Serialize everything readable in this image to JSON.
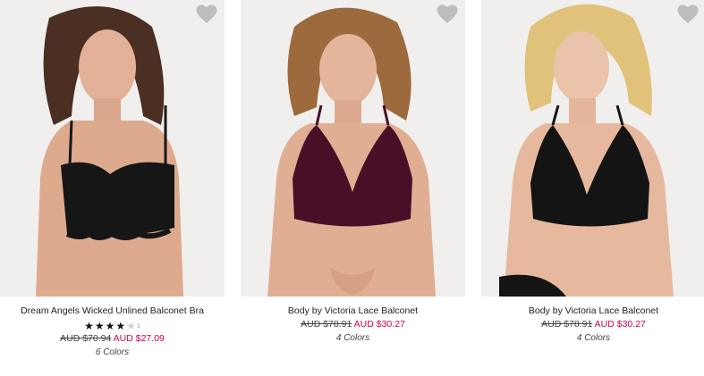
{
  "colors": {
    "sale_price": "#c8005a",
    "heart": "#bdbdbd",
    "star_full": "#111111",
    "star_empty": "#cfcfcf"
  },
  "products": [
    {
      "name": "Dream Angels Wicked Unlined Balconet Bra",
      "rating_stars": "★★★★",
      "rating_empty": "★",
      "rating_value": 4,
      "rating_count": "1",
      "old_price": "AUD $70.94",
      "sale_price": "AUD $27.09",
      "colors_label": "6 Colors",
      "favorite_icon": "heart-icon",
      "hair": "#4a2f22",
      "garment": "#161616"
    },
    {
      "name": "Body by Victoria Lace Balconet",
      "old_price": "AUD $78.91",
      "sale_price": "AUD $30.27",
      "colors_label": "4 Colors",
      "favorite_icon": "heart-icon",
      "hair": "#9c6a3c",
      "garment": "#4a0f26"
    },
    {
      "name": "Body by Victoria Lace Balconet",
      "old_price": "AUD $78.91",
      "sale_price": "AUD $30.27",
      "colors_label": "4 Colors",
      "favorite_icon": "heart-icon",
      "hair": "#e0c27a",
      "garment": "#141414"
    }
  ]
}
